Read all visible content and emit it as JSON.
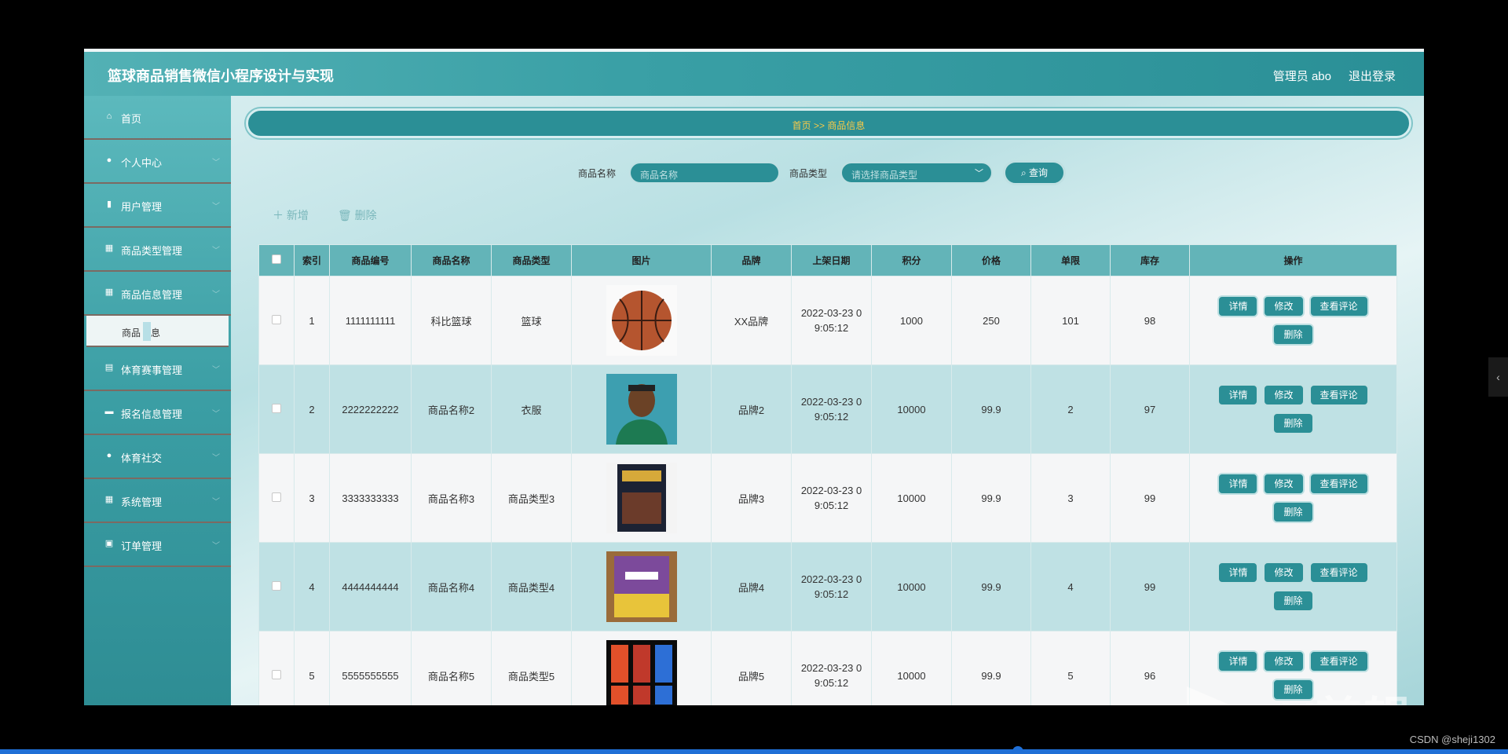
{
  "header": {
    "title": "篮球商品销售微信小程序设计与实现",
    "admin": "管理员 abo",
    "logout": "退出登录"
  },
  "sidebar": {
    "items": [
      {
        "label": "首页",
        "icon": "home-icon"
      },
      {
        "label": "个人中心",
        "icon": "user-icon"
      },
      {
        "label": "用户管理",
        "icon": "users-icon"
      },
      {
        "label": "商品类型管理",
        "icon": "grid-icon"
      },
      {
        "label": "商品信息管理",
        "icon": "grid-icon"
      },
      {
        "label": "体育赛事管理",
        "icon": "clipboard-icon"
      },
      {
        "label": "报名信息管理",
        "icon": "chat-icon"
      },
      {
        "label": "体育社交",
        "icon": "user-icon"
      },
      {
        "label": "系统管理",
        "icon": "grid-icon"
      },
      {
        "label": "订单管理",
        "icon": "lock-icon"
      }
    ],
    "submenu": {
      "parts": [
        "商品",
        "息"
      ]
    }
  },
  "breadcrumb": "首页 >> 商品信息",
  "search": {
    "name_label": "商品名称",
    "name_placeholder": "商品名称",
    "type_label": "商品类型",
    "type_placeholder": "请选择商品类型",
    "button": "查询"
  },
  "actions": {
    "add": "新增",
    "delete": "删除"
  },
  "table": {
    "headers": [
      "索引",
      "商品编号",
      "商品名称",
      "商品类型",
      "图片",
      "品牌",
      "上架日期",
      "积分",
      "价格",
      "单限",
      "库存",
      "操作"
    ],
    "rows": [
      {
        "idx": "1",
        "code": "1111111111",
        "name": "科比篮球",
        "type": "篮球",
        "brand": "XX品牌",
        "date1": "2022-03-23 0",
        "date2": "9:05:12",
        "points": "1000",
        "price": "250",
        "limit": "101",
        "stock": "98"
      },
      {
        "idx": "2",
        "code": "2222222222",
        "name": "商品名称2",
        "type": "衣服",
        "brand": "品牌2",
        "date1": "2022-03-23 0",
        "date2": "9:05:12",
        "points": "10000",
        "price": "99.9",
        "limit": "2",
        "stock": "97"
      },
      {
        "idx": "3",
        "code": "3333333333",
        "name": "商品名称3",
        "type": "商品类型3",
        "brand": "品牌3",
        "date1": "2022-03-23 0",
        "date2": "9:05:12",
        "points": "10000",
        "price": "99.9",
        "limit": "3",
        "stock": "99"
      },
      {
        "idx": "4",
        "code": "4444444444",
        "name": "商品名称4",
        "type": "商品类型4",
        "brand": "品牌4",
        "date1": "2022-03-23 0",
        "date2": "9:05:12",
        "points": "10000",
        "price": "99.9",
        "limit": "4",
        "stock": "99"
      },
      {
        "idx": "5",
        "code": "5555555555",
        "name": "商品名称5",
        "type": "商品类型5",
        "brand": "品牌5",
        "date1": "2022-03-23 0",
        "date2": "9:05:12",
        "points": "10000",
        "price": "99.9",
        "limit": "5",
        "stock": "96"
      }
    ],
    "ops": {
      "detail": "详情",
      "edit": "修改",
      "comments": "查看评论",
      "delete": "删除"
    }
  },
  "watermark": "eV剪辑",
  "credit": "CSDN @sheji1302",
  "colors": {
    "accent": "#2b8f96",
    "breadcrumb_text": "#f7c948",
    "header": "#3aa0a6"
  }
}
